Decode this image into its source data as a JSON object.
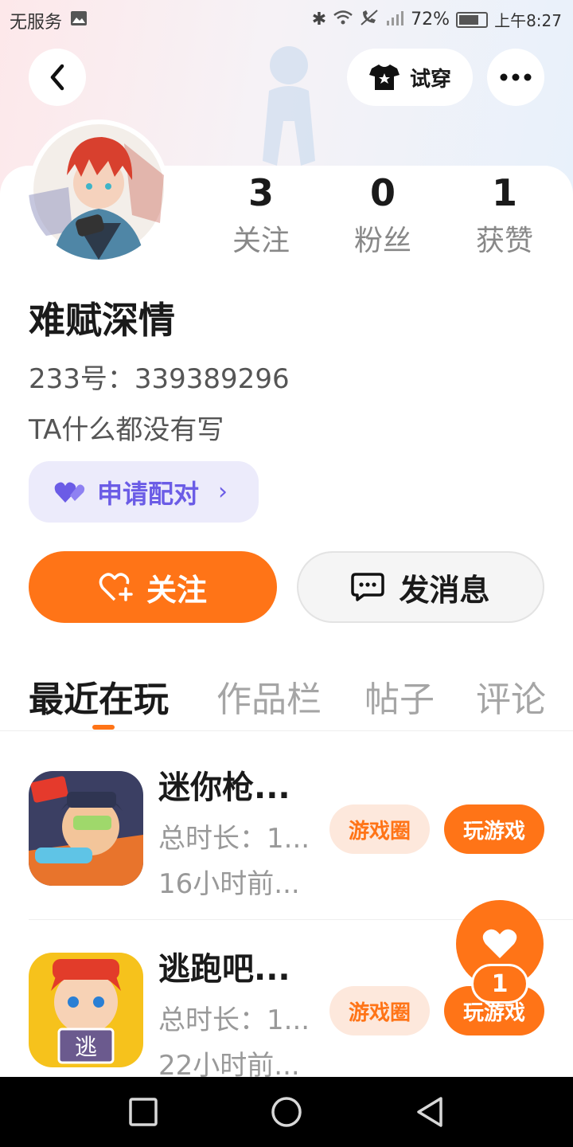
{
  "status_bar": {
    "carrier": "无服务",
    "battery": "72%",
    "time": "上午8:27"
  },
  "header": {
    "try_on_label": "试穿"
  },
  "profile": {
    "stats": [
      {
        "value": "3",
        "label": "关注"
      },
      {
        "value": "0",
        "label": "粉丝"
      },
      {
        "value": "1",
        "label": "获赞"
      }
    ],
    "name": "难赋深情",
    "id_text": "233号：339389296",
    "bio": "TA什么都没有写",
    "pair_label": "申请配对"
  },
  "actions": {
    "follow_label": "关注",
    "message_label": "发消息"
  },
  "tabs": [
    {
      "label": "最近在玩",
      "active": true
    },
    {
      "label": "作品栏",
      "active": false
    },
    {
      "label": "帖子",
      "active": false
    },
    {
      "label": "评论",
      "active": false
    }
  ],
  "games": [
    {
      "title": "迷你枪...",
      "duration": "总时长：1...",
      "last_played": "16小时前...",
      "circle_label": "游戏圈",
      "play_label": "玩游戏"
    },
    {
      "title": "逃跑吧...",
      "duration": "总时长：1...",
      "last_played": "22小时前...",
      "circle_label": "游戏圈",
      "play_label": "玩游戏"
    }
  ],
  "like_fab": {
    "count": "1"
  },
  "colors": {
    "accent": "#ff7417",
    "pair_purple": "#6b5ce6"
  }
}
